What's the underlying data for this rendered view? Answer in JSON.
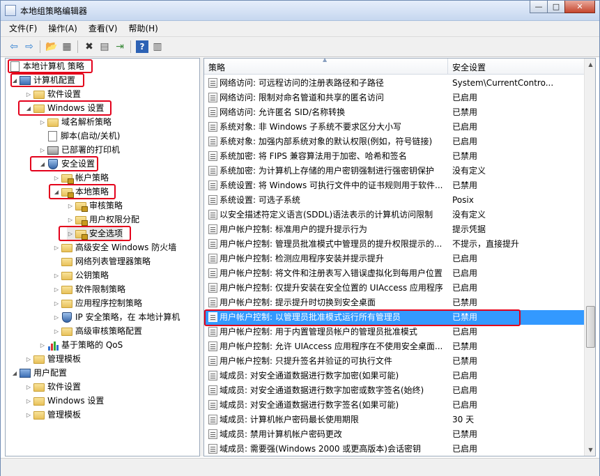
{
  "window": {
    "title": "本地组策略编辑器",
    "caption": {
      "minimize": "—",
      "maximize": "□",
      "close": "✕"
    }
  },
  "menu": [
    "文件(F)",
    "操作(A)",
    "查看(V)",
    "帮助(H)"
  ],
  "toolbar": {
    "back": "⇦",
    "forward": "⇨",
    "up": "📂",
    "show_tree": "▦",
    "delete": "✖",
    "properties": "▤",
    "export": "⇥",
    "help": "?",
    "view": "▥"
  },
  "tree": [
    {
      "label": "本地计算机 策略",
      "icon": "document-icon"
    },
    {
      "label": "计算机配置",
      "icon": "computer-icon"
    },
    {
      "label": "软件设置",
      "icon": "folder-icon"
    },
    {
      "label": "Windows 设置",
      "icon": "folder-icon"
    },
    {
      "label": "域名解析策略",
      "icon": "folder-icon"
    },
    {
      "label": "脚本(启动/关机)",
      "icon": "document-icon"
    },
    {
      "label": "已部署的打印机",
      "icon": "printer-icon"
    },
    {
      "label": "安全设置",
      "icon": "shield-icon"
    },
    {
      "label": "帐户策略",
      "icon": "locked-folder-icon"
    },
    {
      "label": "本地策略",
      "icon": "locked-folder-icon"
    },
    {
      "label": "审核策略",
      "icon": "locked-folder-icon"
    },
    {
      "label": "用户权限分配",
      "icon": "locked-folder-icon"
    },
    {
      "label": "安全选项",
      "icon": "locked-folder-icon"
    },
    {
      "label": "高级安全 Windows 防火墙",
      "icon": "folder-icon"
    },
    {
      "label": "网络列表管理器策略",
      "icon": "folder-icon"
    },
    {
      "label": "公钥策略",
      "icon": "folder-icon"
    },
    {
      "label": "软件限制策略",
      "icon": "folder-icon"
    },
    {
      "label": "应用程序控制策略",
      "icon": "folder-icon"
    },
    {
      "label": "IP 安全策略，在 本地计算机",
      "icon": "shield-icon"
    },
    {
      "label": "高级审核策略配置",
      "icon": "folder-icon"
    },
    {
      "label": "基于策略的 QoS",
      "icon": "chart-icon"
    },
    {
      "label": "管理模板",
      "icon": "folder-icon"
    },
    {
      "label": "用户配置",
      "icon": "computer-icon"
    },
    {
      "label": "软件设置",
      "icon": "folder-icon"
    },
    {
      "label": "Windows 设置",
      "icon": "folder-icon"
    },
    {
      "label": "管理模板",
      "icon": "folder-icon"
    }
  ],
  "columns": {
    "policy": "策略",
    "setting": "安全设置"
  },
  "policies": [
    {
      "policy": "网络访问: 可远程访问的注册表路径和子路径",
      "setting": "System\\CurrentContro..."
    },
    {
      "policy": "网络访问: 限制对命名管道和共享的匿名访问",
      "setting": "已启用"
    },
    {
      "policy": "网络访问: 允许匿名 SID/名称转换",
      "setting": "已禁用"
    },
    {
      "policy": "系统对象: 非 Windows 子系统不要求区分大小写",
      "setting": "已启用"
    },
    {
      "policy": "系统对象: 加强内部系统对象的默认权限(例如，符号链接)",
      "setting": "已启用"
    },
    {
      "policy": "系统加密: 将 FIPS 兼容算法用于加密、哈希和签名",
      "setting": "已禁用"
    },
    {
      "policy": "系统加密: 为计算机上存储的用户密钥强制进行强密钥保护",
      "setting": "没有定义"
    },
    {
      "policy": "系统设置: 将 Windows 可执行文件中的证书规则用于软件...",
      "setting": "已禁用"
    },
    {
      "policy": "系统设置: 可选子系统",
      "setting": "Posix"
    },
    {
      "policy": "以安全描述符定义语言(SDDL)语法表示的计算机访问限制",
      "setting": "没有定义"
    },
    {
      "policy": "用户帐户控制: 标准用户的提升提示行为",
      "setting": "提示凭据"
    },
    {
      "policy": "用户帐户控制: 管理员批准模式中管理员的提升权限提示的...",
      "setting": "不提示，直接提升"
    },
    {
      "policy": "用户帐户控制: 检测应用程序安装并提示提升",
      "setting": "已启用"
    },
    {
      "policy": "用户帐户控制: 将文件和注册表写入错误虚拟化到每用户位置",
      "setting": "已启用"
    },
    {
      "policy": "用户帐户控制: 仅提升安装在安全位置的 UIAccess 应用程序",
      "setting": "已启用"
    },
    {
      "policy": "用户帐户控制: 提示提升时切换到安全桌面",
      "setting": "已禁用"
    },
    {
      "policy": "用户帐户控制: 以管理员批准模式运行所有管理员",
      "setting": "已禁用"
    },
    {
      "policy": "用户帐户控制: 用于内置管理员帐户的管理员批准模式",
      "setting": "已启用"
    },
    {
      "policy": "用户帐户控制: 允许 UIAccess 应用程序在不使用安全桌面...",
      "setting": "已禁用"
    },
    {
      "policy": "用户帐户控制: 只提升签名并验证的可执行文件",
      "setting": "已禁用"
    },
    {
      "policy": "域成员: 对安全通道数据进行数字加密(如果可能)",
      "setting": "已启用"
    },
    {
      "policy": "域成员: 对安全通道数据进行数字加密或数字签名(始终)",
      "setting": "已启用"
    },
    {
      "policy": "域成员: 对安全通道数据进行数字签名(如果可能)",
      "setting": "已启用"
    },
    {
      "policy": "域成员: 计算机帐户密码最长使用期限",
      "setting": "30 天"
    },
    {
      "policy": "域成员: 禁用计算机帐户密码更改",
      "setting": "已禁用"
    },
    {
      "policy": "域成员: 需要强(Windows 2000 或更高版本)会话密钥",
      "setting": "已启用"
    }
  ]
}
